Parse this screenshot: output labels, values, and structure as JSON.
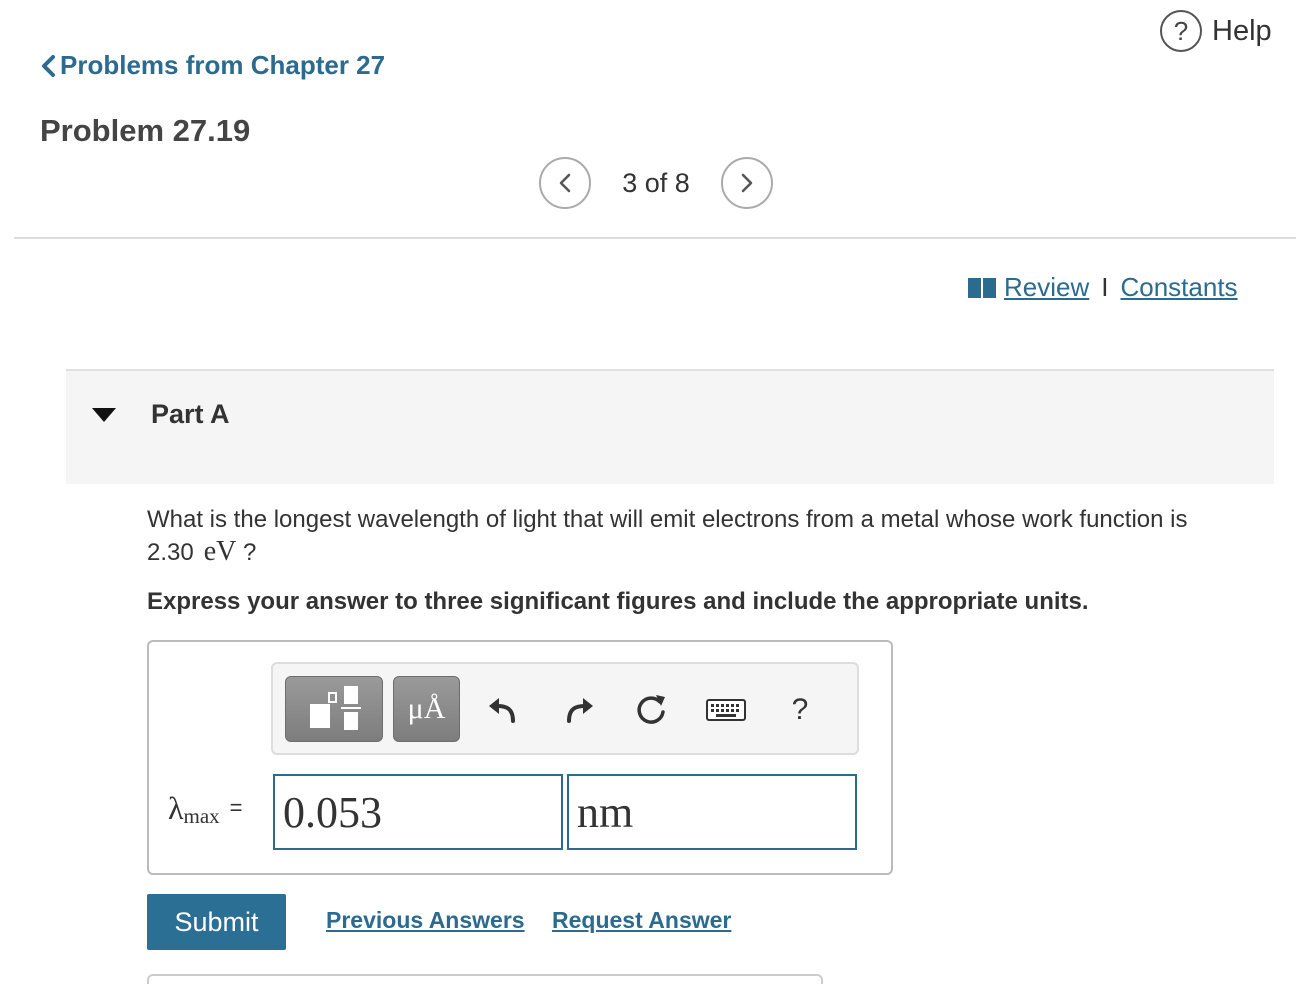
{
  "header": {
    "help_icon": "?",
    "help_label": "Help",
    "back_link": "Problems from Chapter 27",
    "problem_title": "Problem 27.19",
    "pager": {
      "text": "3 of 8",
      "prev_icon": "<",
      "next_icon": ">"
    }
  },
  "resources": {
    "review": "Review",
    "separator": "I",
    "constants": "Constants"
  },
  "part": {
    "label": "Part A",
    "question_text": "What is the longest wavelength of light that will emit electrons from a metal whose work function is 2.30",
    "question_unit": "eV",
    "question_end": "?",
    "instruction": "Express your answer to three significant figures and include the appropriate units."
  },
  "answer": {
    "toolbar": {
      "units_label": "μÅ",
      "help": "?"
    },
    "variable": "λ",
    "variable_sub": "max",
    "equals": "=",
    "value": "0.053",
    "unit": "nm"
  },
  "actions": {
    "submit": "Submit",
    "previous_answers": "Previous Answers",
    "request_answer": "Request Answer"
  },
  "colors": {
    "link": "#2b6b90",
    "submit_bg": "#2b6f95"
  }
}
